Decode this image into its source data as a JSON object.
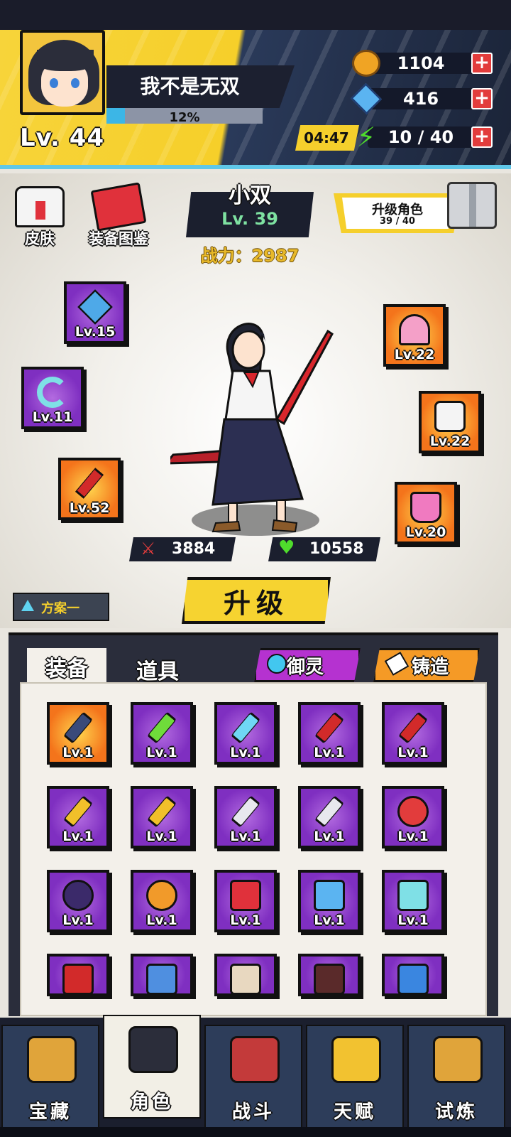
{
  "player": {
    "name": "我不是无双",
    "level": "Lv. 44",
    "exp_text": "12%",
    "exp_fraction": 0.12
  },
  "resources": {
    "coins": "1104",
    "gems": "416",
    "energy": "10 / 40",
    "timer": "04:47",
    "plus_symbol": "+"
  },
  "side_buttons": {
    "skin": "皮肤",
    "codex": "装备图鉴"
  },
  "character": {
    "name": "小双",
    "level": "Lv. 39",
    "power": "战力：2987",
    "attack": "3884",
    "hp": "10558"
  },
  "upgrade_role": {
    "label": "升级角色",
    "progress": "39 / 40"
  },
  "equipped": {
    "left": [
      {
        "level": "Lv.15",
        "icon": "amulet-icon",
        "rarity": "purple"
      },
      {
        "level": "Lv.11",
        "icon": "jade-ring-icon",
        "rarity": "purple"
      },
      {
        "level": "Lv.52",
        "icon": "red-sword-icon",
        "rarity": "orange"
      }
    ],
    "right": [
      {
        "level": "Lv.22",
        "icon": "helmet-icon",
        "rarity": "orange"
      },
      {
        "level": "Lv.22",
        "icon": "uniform-icon",
        "rarity": "orange"
      },
      {
        "level": "Lv.20",
        "icon": "roller-skate-icon",
        "rarity": "orange"
      }
    ]
  },
  "upgrade_button": "升级",
  "plan": "方案一",
  "tabs": {
    "equipment": "装备",
    "items": "道具",
    "yuling": "御灵",
    "forge": "铸造"
  },
  "inventory": [
    {
      "level": "Lv.1",
      "icon": "dark-blade-icon",
      "rarity": "orange"
    },
    {
      "level": "Lv.1",
      "icon": "green-blade-icon",
      "rarity": "purple"
    },
    {
      "level": "Lv.1",
      "icon": "blue-blade-icon",
      "rarity": "purple"
    },
    {
      "level": "Lv.1",
      "icon": "red-sword-icon",
      "rarity": "purple"
    },
    {
      "level": "Lv.1",
      "icon": "red-sword-icon",
      "rarity": "purple"
    },
    {
      "level": "Lv.1",
      "icon": "gold-blade-icon",
      "rarity": "purple"
    },
    {
      "level": "Lv.1",
      "icon": "gold-blade-icon",
      "rarity": "purple"
    },
    {
      "level": "Lv.1",
      "icon": "silver-blade-icon",
      "rarity": "purple"
    },
    {
      "level": "Lv.1",
      "icon": "silver-blade-icon",
      "rarity": "purple"
    },
    {
      "level": "Lv.1",
      "icon": "red-ring-icon",
      "rarity": "purple"
    },
    {
      "level": "Lv.1",
      "icon": "dark-ring-icon",
      "rarity": "purple"
    },
    {
      "level": "Lv.1",
      "icon": "dragon-ring-icon",
      "rarity": "purple"
    },
    {
      "level": "Lv.1",
      "icon": "red-book-icon",
      "rarity": "purple"
    },
    {
      "level": "Lv.1",
      "icon": "lightning-charm-icon",
      "rarity": "purple"
    },
    {
      "level": "Lv.1",
      "icon": "jade-necklace-icon",
      "rarity": "purple"
    },
    {
      "level": "",
      "icon": "red-scarf-icon",
      "rarity": "purple"
    },
    {
      "level": "",
      "icon": "blue-hat-icon",
      "rarity": "purple"
    },
    {
      "level": "",
      "icon": "boot-icon",
      "rarity": "purple"
    },
    {
      "level": "",
      "icon": "brown-boot-icon",
      "rarity": "purple"
    },
    {
      "level": "",
      "icon": "blue-sandal-icon",
      "rarity": "purple"
    }
  ],
  "nav": [
    {
      "label": "宝藏",
      "icon": "treasure-chest-icon",
      "color": "#e0a43a"
    },
    {
      "label": "角色",
      "icon": "character-icon",
      "color": "#2b2d3a"
    },
    {
      "label": "战斗",
      "icon": "swords-icon",
      "color": "#c33a3a"
    },
    {
      "label": "天赋",
      "icon": "lightbulb-icon",
      "color": "#f2c230"
    },
    {
      "label": "试炼",
      "icon": "trophy-icon",
      "color": "#e0a43a"
    }
  ],
  "colors": {
    "purple_slot": "#7f2fc1",
    "orange_slot": "#f4741b",
    "accent_yellow": "#f5cf2c",
    "nav_bg": "#2d3d5a"
  }
}
